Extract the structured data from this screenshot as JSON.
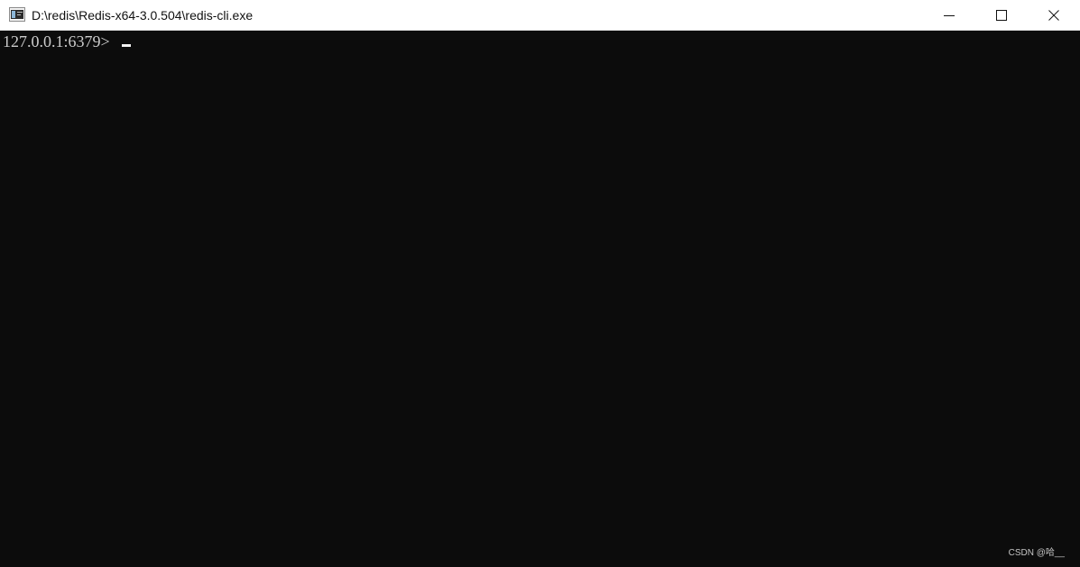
{
  "window": {
    "title": "D:\\redis\\Redis-x64-3.0.504\\redis-cli.exe",
    "icon": "console-window-icon",
    "controls": {
      "minimize": "minimize-icon",
      "maximize": "maximize-icon",
      "close": "close-icon"
    }
  },
  "terminal": {
    "prompt": "127.0.0.1:6379>",
    "cursor_visible": true,
    "background": "#0c0c0c",
    "foreground": "#cccccc"
  },
  "watermark": {
    "text": "CSDN @哈__"
  },
  "colors": {
    "titlebar_bg": "#ffffff",
    "titlebar_text": "#111111",
    "terminal_bg": "#0c0c0c",
    "terminal_text": "#cccccc",
    "cursor": "#f2f2f2"
  }
}
